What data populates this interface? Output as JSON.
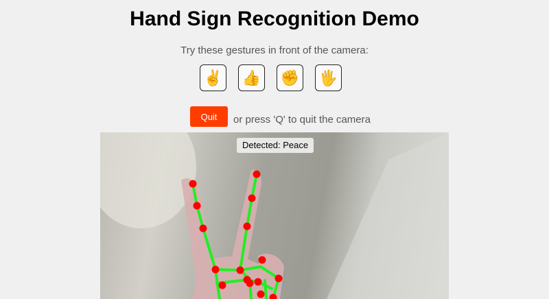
{
  "page": {
    "title": "Hand Sign Recognition Demo",
    "subtitle": "Try these gestures in front of the camera:"
  },
  "gestures": [
    {
      "emoji": "✌️",
      "icon": "peace-hand-icon"
    },
    {
      "emoji": "👍",
      "icon": "thumbs-up-icon"
    },
    {
      "emoji": "✊",
      "icon": "fist-icon"
    },
    {
      "emoji": "🖐️",
      "icon": "open-hand-icon"
    }
  ],
  "controls": {
    "quit_label": "Quit",
    "quit_hint": "or press 'Q' to quit the camera",
    "quit_color": "#ff3d00"
  },
  "camera": {
    "detected_label": "Detected: Peace",
    "landmark_color": "#ff0000",
    "skeleton_color": "#22ee22"
  }
}
